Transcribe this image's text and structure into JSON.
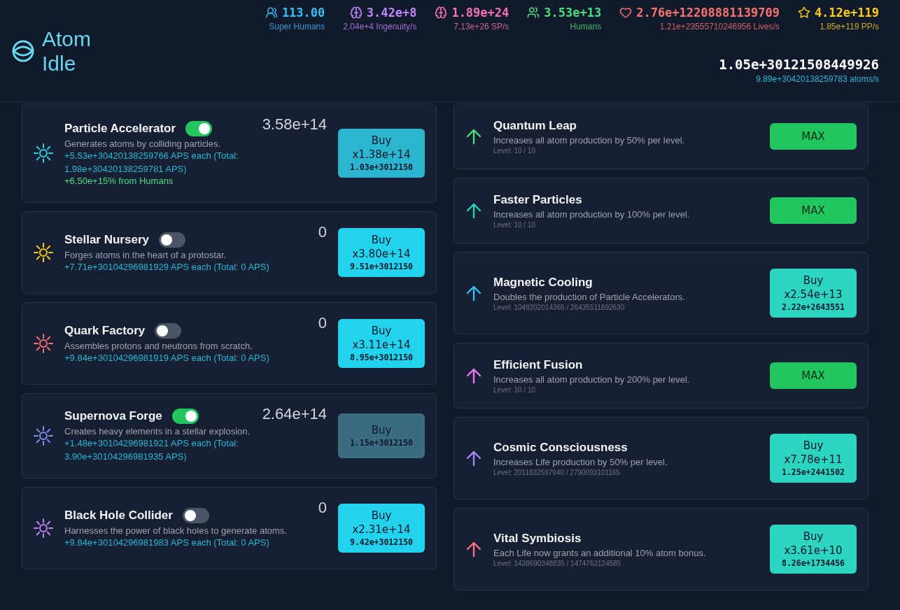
{
  "logo": {
    "title": "Atom Idle"
  },
  "stats": [
    {
      "kind": "super-humans",
      "value": "113.00",
      "label": "Super Humans",
      "color": "#38bdf8"
    },
    {
      "kind": "ingenuity",
      "value": "3.42e+8",
      "label": "2.04e+4 Ingenuity/s",
      "color": "#c084fc"
    },
    {
      "kind": "sp",
      "value": "1.89e+24",
      "label": "7.13e+26 SP/s",
      "color": "#f472b6"
    },
    {
      "kind": "humans",
      "value": "3.53e+13",
      "label": "Humans",
      "color": "#4ade80"
    },
    {
      "kind": "lives",
      "value": "2.76e+12208881139709",
      "label": "1.21e+23555710246956 Lives/s",
      "color": "#f87171"
    },
    {
      "kind": "pp",
      "value": "4.12e+119",
      "label": "1.85e+119 PP/s",
      "color": "#facc15"
    }
  ],
  "atoms": {
    "value": "1.05e+30121508449926",
    "rate": "9.89e+30420138259783 atoms/s"
  },
  "generators": [
    {
      "name": "Particle Accelerator",
      "on": true,
      "count": "3.58e+14",
      "description": "Generates atoms by colliding particles.",
      "production": "+5.53e+30420138259766 APS each (Total: 1.98e+30420138259781 APS)",
      "bonus": "+6.50e+15% from Humans",
      "color": "#22d3ee",
      "buy": {
        "label": "Buy",
        "amount": "x1.38e+14",
        "cost": "1.03e+3012150",
        "hovered": true,
        "disabled": false
      }
    },
    {
      "name": "Stellar Nursery",
      "on": false,
      "count": "0",
      "description": "Forges atoms in the heart of a protostar.",
      "production": "+7.71e+30104296981929 APS each (Total: 0 APS)",
      "color": "#facc15",
      "buy": {
        "label": "Buy",
        "amount": "x3.80e+14",
        "cost": "9.51e+3012150",
        "hovered": false,
        "disabled": false
      }
    },
    {
      "name": "Quark Factory",
      "on": false,
      "count": "0",
      "description": "Assembles protons and neutrons from scratch.",
      "production": "+9.84e+30104296981919 APS each (Total: 0 APS)",
      "color": "#f87171",
      "buy": {
        "label": "Buy",
        "amount": "x3.11e+14",
        "cost": "8.95e+3012150",
        "hovered": false,
        "disabled": false
      }
    },
    {
      "name": "Supernova Forge",
      "on": true,
      "count": "2.64e+14",
      "description": "Creates heavy elements in a stellar explosion.",
      "production": "+1.48e+30104296981921 APS each (Total: 3.90e+30104296981935 APS)",
      "color": "#818cf8",
      "buy": {
        "label": "Buy",
        "cost": "1.15e+3012150",
        "hovered": false,
        "disabled": true
      }
    },
    {
      "name": "Black Hole Collider",
      "on": false,
      "count": "0",
      "description": "Harnesses the power of black holes to generate atoms.",
      "production": "+9.84e+30104296981983 APS each (Total: 0 APS)",
      "color": "#c084fc",
      "buy": {
        "label": "Buy",
        "amount": "x2.31e+14",
        "cost": "9.42e+3012150",
        "hovered": false,
        "disabled": false
      }
    }
  ],
  "upgrades": [
    {
      "name": "Quantum Leap",
      "description": "Increases all atom production by 50% per level.",
      "level": "Level: 10 / 10",
      "color": "#4ade80",
      "button": {
        "kind": "max",
        "label": "MAX"
      }
    },
    {
      "name": "Faster Particles",
      "description": "Increases all atom production by 100% per level.",
      "level": "Level: 10 / 10",
      "color": "#2dd4bf",
      "button": {
        "kind": "max",
        "label": "MAX"
      }
    },
    {
      "name": "Magnetic Cooling",
      "description": "Doubles the production of Particle Accelerators.",
      "level": "Level: 1049202014365 / 26435511892630",
      "color": "#38bdf8",
      "button": {
        "kind": "buy",
        "label": "Buy",
        "amount": "x2.54e+13",
        "cost": "2.22e+2643551"
      }
    },
    {
      "name": "Efficient Fusion",
      "description": "Increases all atom production by 200% per level.",
      "level": "Level: 10 / 10",
      "color": "#e879f9",
      "button": {
        "kind": "max",
        "label": "MAX"
      }
    },
    {
      "name": "Cosmic Consciousness",
      "description": "Increases Life production by 50% per level.",
      "level": "Level: 2011832597940 / 2790093101165",
      "color": "#a78bfa",
      "button": {
        "kind": "buy",
        "label": "Buy",
        "amount": "x7.78e+11",
        "cost": "1.25e+2441502"
      }
    },
    {
      "name": "Vital Symbiosis",
      "description": "Each Life now grants an additional 10% atom bonus.",
      "level": "Level: 1438690348835 / 1474763124585",
      "color": "#fb7185",
      "button": {
        "kind": "buy",
        "label": "Buy",
        "amount": "x3.61e+10",
        "cost": "8.26e+1734456"
      }
    }
  ]
}
